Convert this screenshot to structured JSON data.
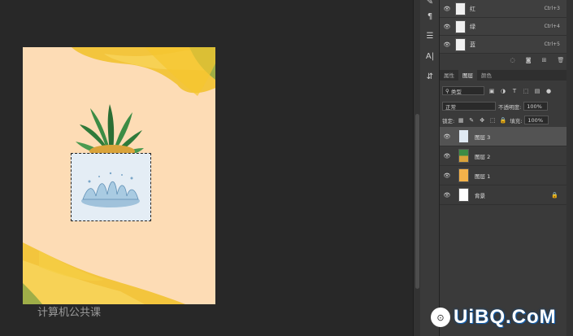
{
  "channels": [
    {
      "name": "红",
      "shortcut": "Ctrl+3"
    },
    {
      "name": "绿",
      "shortcut": "Ctrl+4"
    },
    {
      "name": "蓝",
      "shortcut": "Ctrl+5"
    }
  ],
  "panel_tabs": [
    "属性",
    "图层",
    "颜色"
  ],
  "active_tab": "图层",
  "filter": {
    "kind": "类型"
  },
  "blend": {
    "mode": "正常",
    "opacity_label": "不透明度:",
    "opacity": "100%"
  },
  "lock": {
    "label": "锁定:",
    "fill_label": "填充:",
    "fill": "100%"
  },
  "layers": [
    {
      "name": "图层 3",
      "selected": true
    },
    {
      "name": "图层 2",
      "selected": false
    },
    {
      "name": "图层 1",
      "selected": false
    },
    {
      "name": "背景",
      "selected": false,
      "locked": true
    }
  ],
  "watermark": {
    "logo": "⊙",
    "text": "UiBQ.CoM",
    "behind": "计算机公共课"
  },
  "colors": {
    "canvas_bg": "#fddcb5",
    "workspace": "#282828",
    "panel": "#3a3a3a",
    "brush": "#f2c230"
  }
}
